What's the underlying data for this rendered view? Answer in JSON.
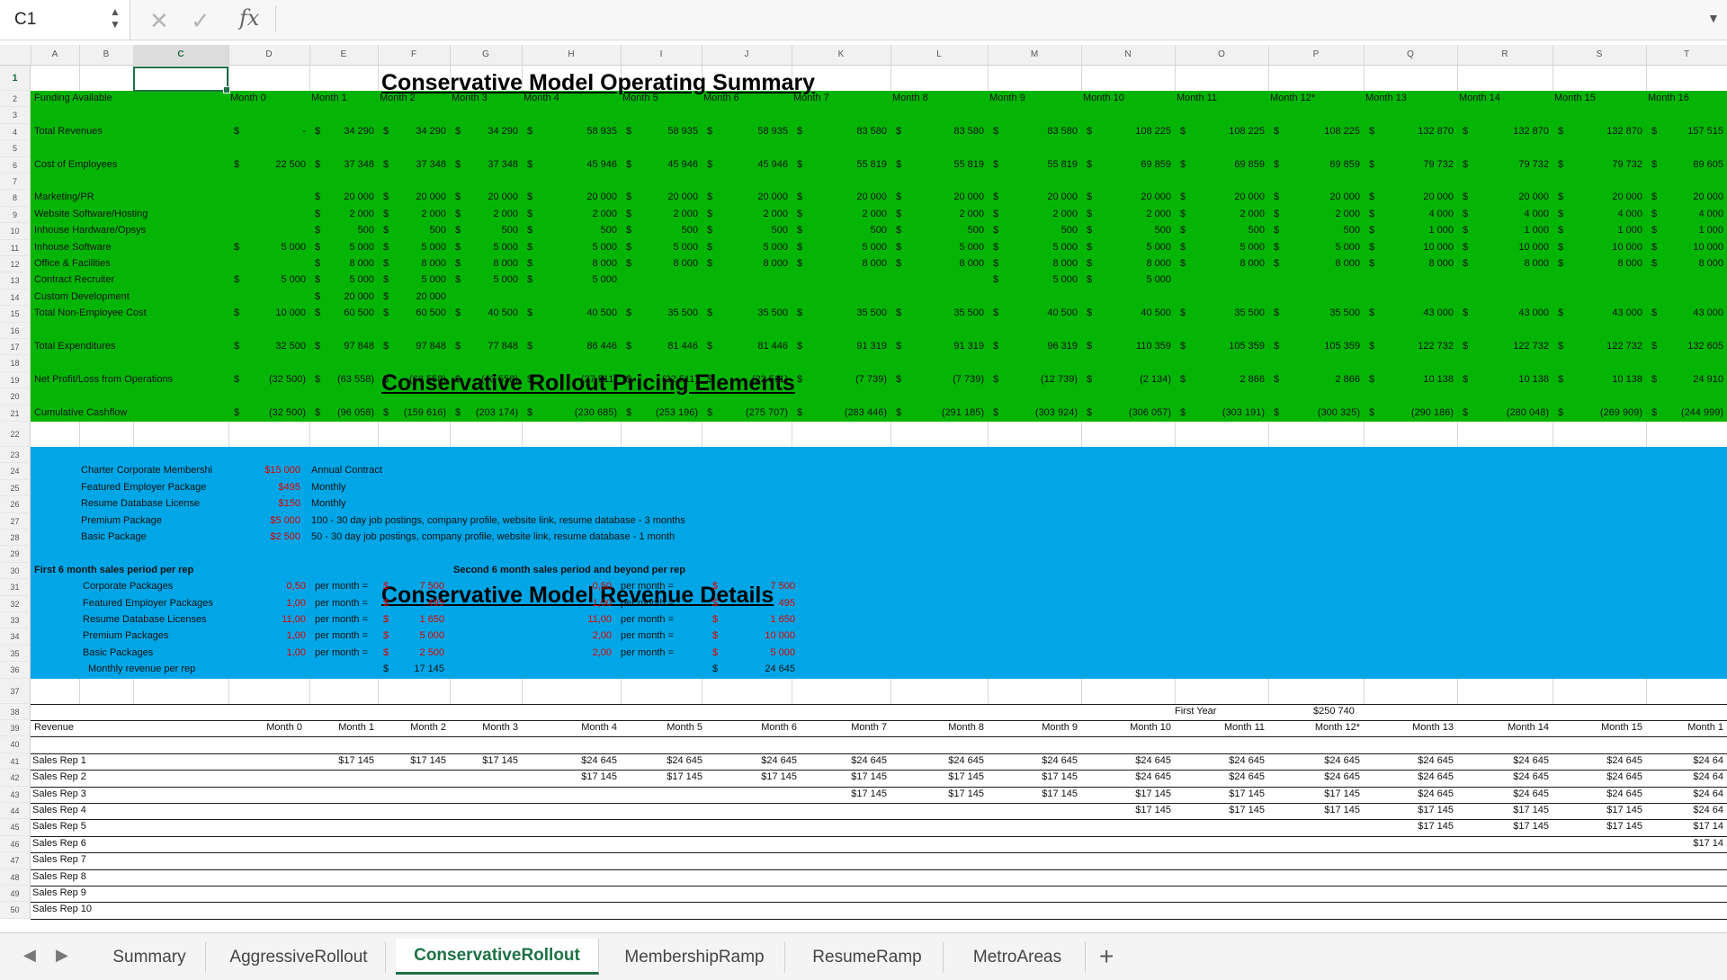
{
  "namebox": {
    "cell": "C1",
    "spin": "▲\n▼"
  },
  "formula": {
    "cancel": "✕",
    "enter": "✓",
    "fx": "fx",
    "value": "",
    "expand": "▼"
  },
  "column_headers": [
    "A",
    "B",
    "C",
    "D",
    "E",
    "F",
    "G",
    "H",
    "I",
    "J",
    "K",
    "L",
    "M",
    "N",
    "O",
    "P",
    "Q",
    "R",
    "S",
    "T"
  ],
  "selected_column": "C",
  "row_numbers": [
    "1",
    "2",
    "3",
    "4",
    "5",
    "6",
    "7",
    "8",
    "9",
    "10",
    "11",
    "12",
    "13",
    "14",
    "15",
    "16",
    "17",
    "18",
    "19",
    "20",
    "21",
    "22",
    "23",
    "24",
    "25",
    "26",
    "27",
    "28",
    "29",
    "30",
    "31",
    "32",
    "33",
    "34",
    "35",
    "36",
    "37",
    "38",
    "39",
    "40",
    "41",
    "42",
    "43",
    "44",
    "45",
    "46",
    "47",
    "48",
    "49",
    "50"
  ],
  "colors": {
    "green": "#05b505",
    "blue": "#00a6e6",
    "light_green": "#c6f5c8",
    "accent": "#1e7145",
    "red": "#e00000"
  },
  "titles": {
    "operating": "Conservative Model Operating Summary",
    "pricing": "Conservative Rollout Pricing Elements",
    "revenue": "Conservative Model Revenue Details"
  },
  "operating": {
    "months": [
      "Month 0",
      "Month 1",
      "Month 2",
      "Month 3",
      "Month 4",
      "Month 5",
      "Month 6",
      "Month 7",
      "Month 8",
      "Month 9",
      "Month 10",
      "Month 11",
      "Month 12*",
      "Month 13",
      "Month 14",
      "Month 15",
      "Month 16"
    ],
    "header_label": "Funding Available",
    "rows": [
      {
        "row": 4,
        "label": "Total Revenues",
        "values": [
          "-",
          "34 290",
          "34 290",
          "34 290",
          "58 935",
          "58 935",
          "58 935",
          "83 580",
          "83 580",
          "83 580",
          "108 225",
          "108 225",
          "108 225",
          "132 870",
          "132 870",
          "132 870",
          "157 515"
        ]
      },
      {
        "row": 6,
        "label": "Cost of Employees",
        "values": [
          "22 500",
          "37 348",
          "37 348",
          "37 348",
          "45 946",
          "45 946",
          "45 946",
          "55 819",
          "55 819",
          "55 819",
          "69 859",
          "69 859",
          "69 859",
          "79 732",
          "79 732",
          "79 732",
          "89 605"
        ]
      },
      {
        "row": 8,
        "label": "Marketing/PR",
        "values": [
          "",
          "20 000",
          "20 000",
          "20 000",
          "20 000",
          "20 000",
          "20 000",
          "20 000",
          "20 000",
          "20 000",
          "20 000",
          "20 000",
          "20 000",
          "20 000",
          "20 000",
          "20 000",
          "20 000"
        ]
      },
      {
        "row": 9,
        "label": "Website Software/Hosting",
        "values": [
          "",
          "2 000",
          "2 000",
          "2 000",
          "2 000",
          "2 000",
          "2 000",
          "2 000",
          "2 000",
          "2 000",
          "2 000",
          "2 000",
          "2 000",
          "4 000",
          "4 000",
          "4 000",
          "4 000"
        ]
      },
      {
        "row": 10,
        "label": "Inhouse Hardware/Opsys",
        "values": [
          "",
          "500",
          "500",
          "500",
          "500",
          "500",
          "500",
          "500",
          "500",
          "500",
          "500",
          "500",
          "500",
          "1 000",
          "1 000",
          "1 000",
          "1 000"
        ]
      },
      {
        "row": 11,
        "label": "Inhouse Software",
        "values": [
          "5 000",
          "5 000",
          "5 000",
          "5 000",
          "5 000",
          "5 000",
          "5 000",
          "5 000",
          "5 000",
          "5 000",
          "5 000",
          "5 000",
          "5 000",
          "10 000",
          "10 000",
          "10 000",
          "10 000"
        ]
      },
      {
        "row": 12,
        "label": "Office & Facilities",
        "values": [
          "",
          "8 000",
          "8 000",
          "8 000",
          "8 000",
          "8 000",
          "8 000",
          "8 000",
          "8 000",
          "8 000",
          "8 000",
          "8 000",
          "8 000",
          "8 000",
          "8 000",
          "8 000",
          "8 000"
        ]
      },
      {
        "row": 13,
        "label": "Contract Recruiter",
        "values": [
          "5 000",
          "5 000",
          "5 000",
          "5 000",
          "5 000",
          "",
          "",
          "",
          "",
          "5 000",
          "5 000",
          "",
          "",
          "",
          "",
          "",
          ""
        ]
      },
      {
        "row": 14,
        "label": "Custom Development",
        "values": [
          "",
          "20 000",
          "20 000",
          "",
          "",
          "",
          "",
          "",
          "",
          "",
          "",
          "",
          "",
          "",
          "",
          "",
          ""
        ]
      },
      {
        "row": 15,
        "label": "Total Non-Employee Cost",
        "values": [
          "10 000",
          "60 500",
          "60 500",
          "40 500",
          "40 500",
          "35 500",
          "35 500",
          "35 500",
          "35 500",
          "40 500",
          "40 500",
          "35 500",
          "35 500",
          "43 000",
          "43 000",
          "43 000",
          "43 000"
        ]
      },
      {
        "row": 17,
        "label": "Total Expenditures",
        "values": [
          "32 500",
          "97 848",
          "97 848",
          "77 848",
          "86 446",
          "81 446",
          "81 446",
          "91 319",
          "91 319",
          "96 319",
          "110 359",
          "105 359",
          "105 359",
          "122 732",
          "122 732",
          "122 732",
          "132 605"
        ]
      },
      {
        "row": 19,
        "label": "Net Profit/Loss from Operations",
        "values": [
          "(32 500)",
          "(63 558)",
          "(63 558)",
          "(43 558)",
          "(27 511)",
          "(22 511)",
          "(22 511)",
          "(7 739)",
          "(7 739)",
          "(12 739)",
          "(2 134)",
          "2 866",
          "2 866",
          "10 138",
          "10 138",
          "10 138",
          "24 910"
        ]
      },
      {
        "row": 21,
        "label": "Cumulative Cashflow",
        "values": [
          "(32 500)",
          "(96 058)",
          "(159 616)",
          "(203 174)",
          "(230 685)",
          "(253 196)",
          "(275 707)",
          "(283 446)",
          "(291 185)",
          "(303 924)",
          "(306 057)",
          "(303 191)",
          "(300 325)",
          "(290 186)",
          "(280 048)",
          "(269 909)",
          "(244 999)"
        ]
      }
    ]
  },
  "pricing": {
    "items": [
      {
        "row": 24,
        "name": "Charter Corporate Membershi",
        "price": "$15 000",
        "desc": "Annual Contract"
      },
      {
        "row": 25,
        "name": "Featured Employer Package",
        "price": "$495",
        "desc": "Monthly"
      },
      {
        "row": 26,
        "name": "Resume Database License",
        "price": "$150",
        "desc": "Monthly"
      },
      {
        "row": 27,
        "name": "Premium Package",
        "price": "$5 000",
        "desc": "100 - 30 day job postings, company profile, website link, resume database - 3 months"
      },
      {
        "row": 28,
        "name": "Basic Package",
        "price": "$2 500",
        "desc": "50 - 30 day job postings, company profile, website link, resume database - 1 month"
      }
    ],
    "first_header": "First 6 month sales period per rep",
    "second_header": "Second 6 month sales period  and beyond per rep",
    "per_month": "per month =",
    "dollar": "$",
    "rows": [
      {
        "row": 31,
        "name": "Corporate Packages",
        "q1": "0,50",
        "v1": "7 500",
        "q2": "0,50",
        "v2": "7 500"
      },
      {
        "row": 32,
        "name": "Featured Employer Packages",
        "q1": "1,00",
        "v1": "495",
        "q2": "1,00",
        "v2": "495"
      },
      {
        "row": 33,
        "name": "Resume Database Licenses",
        "q1": "11,00",
        "v1": "1 650",
        "q2": "11,00",
        "v2": "1 650"
      },
      {
        "row": 34,
        "name": "Premium Packages",
        "q1": "1,00",
        "v1": "5 000",
        "q2": "2,00",
        "v2": "10 000"
      },
      {
        "row": 35,
        "name": "Basic Packages",
        "q1": "1,00",
        "v1": "2 500",
        "q2": "2,00",
        "v2": "5 000"
      }
    ],
    "total_label": "Monthly revenue per rep",
    "total1": "17 145",
    "total2": "24 645"
  },
  "revenue": {
    "first_year_label": "First Year",
    "first_year_value": "$250 740",
    "revenue_label": "Revenue",
    "months": [
      "Month 0",
      "Month 1",
      "Month 2",
      "Month 3",
      "Month 4",
      "Month 5",
      "Month 6",
      "Month 7",
      "Month 8",
      "Month 9",
      "Month 10",
      "Month 11",
      "Month 12*",
      "Month 13",
      "Month 14",
      "Month 15",
      "Month 1"
    ],
    "reps": [
      {
        "row": 41,
        "name": "Sales Rep 1",
        "values": [
          "",
          "$17 145",
          "$17 145",
          "$17 145",
          "$24 645",
          "$24 645",
          "$24 645",
          "$24 645",
          "$24 645",
          "$24 645",
          "$24 645",
          "$24 645",
          "$24 645",
          "$24 645",
          "$24 645",
          "$24 645",
          "$24 64"
        ]
      },
      {
        "row": 42,
        "name": "Sales Rep 2",
        "values": [
          "",
          "",
          "",
          "",
          "$17 145",
          "$17 145",
          "$17 145",
          "$17 145",
          "$17 145",
          "$17 145",
          "$24 645",
          "$24 645",
          "$24 645",
          "$24 645",
          "$24 645",
          "$24 645",
          "$24 64"
        ]
      },
      {
        "row": 43,
        "name": "Sales Rep 3",
        "values": [
          "",
          "",
          "",
          "",
          "",
          "",
          "",
          "$17 145",
          "$17 145",
          "$17 145",
          "$17 145",
          "$17 145",
          "$17 145",
          "$24 645",
          "$24 645",
          "$24 645",
          "$24 64"
        ]
      },
      {
        "row": 44,
        "name": "Sales Rep 4",
        "values": [
          "",
          "",
          "",
          "",
          "",
          "",
          "",
          "",
          "",
          "",
          "$17 145",
          "$17 145",
          "$17 145",
          "$17 145",
          "$17 145",
          "$17 145",
          "$24 64"
        ]
      },
      {
        "row": 45,
        "name": "Sales Rep 5",
        "values": [
          "",
          "",
          "",
          "",
          "",
          "",
          "",
          "",
          "",
          "",
          "",
          "",
          "",
          "$17 145",
          "$17 145",
          "$17 145",
          "$17 14"
        ]
      },
      {
        "row": 46,
        "name": "Sales Rep 6",
        "values": [
          "",
          "",
          "",
          "",
          "",
          "",
          "",
          "",
          "",
          "",
          "",
          "",
          "",
          "",
          "",
          "",
          "$17 14"
        ]
      },
      {
        "row": 47,
        "name": "Sales Rep 7",
        "values": []
      },
      {
        "row": 48,
        "name": "Sales Rep 8",
        "values": []
      },
      {
        "row": 49,
        "name": "Sales Rep 9",
        "values": []
      },
      {
        "row": 50,
        "name": "Sales Rep 10",
        "values": []
      }
    ]
  },
  "tabs": {
    "items": [
      "Summary",
      "AggressiveRollout",
      "ConservativeRollout",
      "MembershipRamp",
      "ResumeRamp",
      "MetroAreas"
    ],
    "active": "ConservativeRollout",
    "prev": "◀",
    "next": "▶",
    "add": "+"
  }
}
